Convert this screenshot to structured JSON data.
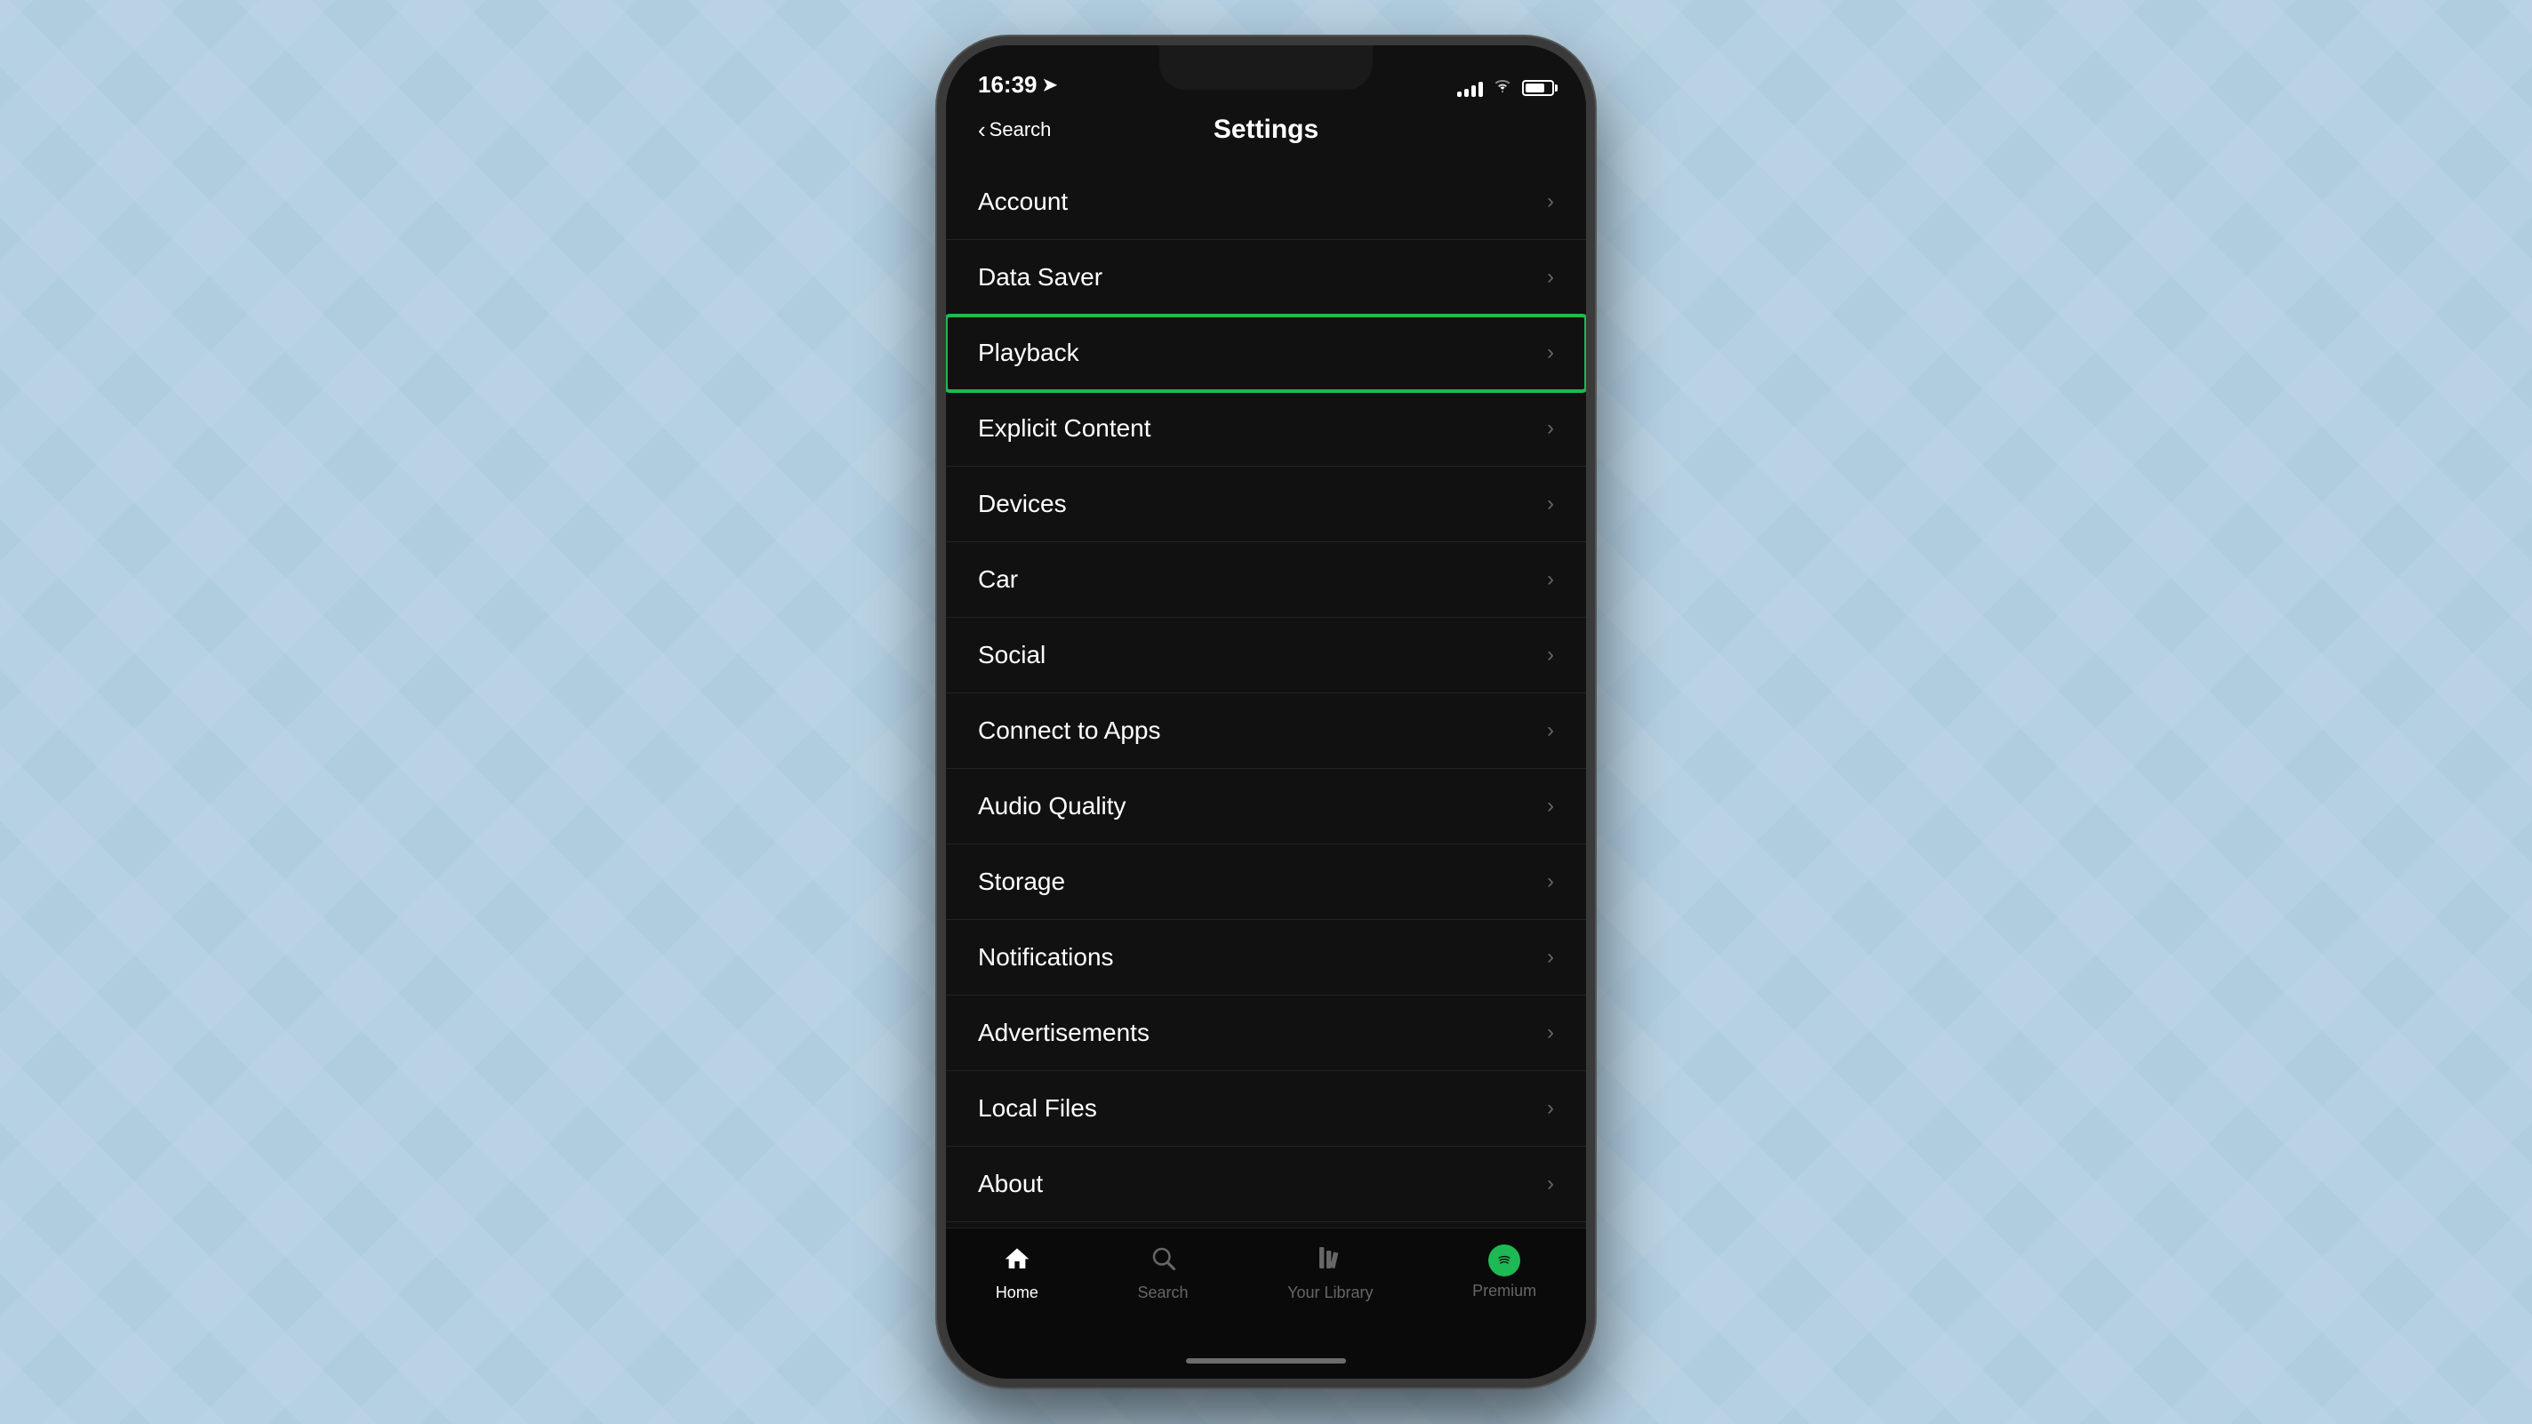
{
  "background": {
    "color": "#b0cde0"
  },
  "status_bar": {
    "time": "16:39",
    "back_label": "Search",
    "page_title": "Settings"
  },
  "settings_items": [
    {
      "id": "account",
      "label": "Account",
      "highlighted": false
    },
    {
      "id": "data-saver",
      "label": "Data Saver",
      "highlighted": false
    },
    {
      "id": "playback",
      "label": "Playback",
      "highlighted": true
    },
    {
      "id": "explicit-content",
      "label": "Explicit Content",
      "highlighted": false
    },
    {
      "id": "devices",
      "label": "Devices",
      "highlighted": false
    },
    {
      "id": "car",
      "label": "Car",
      "highlighted": false
    },
    {
      "id": "social",
      "label": "Social",
      "highlighted": false
    },
    {
      "id": "connect-to-apps",
      "label": "Connect to Apps",
      "highlighted": false
    },
    {
      "id": "audio-quality",
      "label": "Audio Quality",
      "highlighted": false
    },
    {
      "id": "storage",
      "label": "Storage",
      "highlighted": false
    },
    {
      "id": "notifications",
      "label": "Notifications",
      "highlighted": false
    },
    {
      "id": "advertisements",
      "label": "Advertisements",
      "highlighted": false
    },
    {
      "id": "local-files",
      "label": "Local Files",
      "highlighted": false
    },
    {
      "id": "about",
      "label": "About",
      "highlighted": false
    }
  ],
  "tab_bar": {
    "items": [
      {
        "id": "home",
        "label": "Home",
        "active": true
      },
      {
        "id": "search",
        "label": "Search",
        "active": false
      },
      {
        "id": "your-library",
        "label": "Your Library",
        "active": false
      },
      {
        "id": "premium",
        "label": "Premium",
        "active": false
      }
    ]
  }
}
